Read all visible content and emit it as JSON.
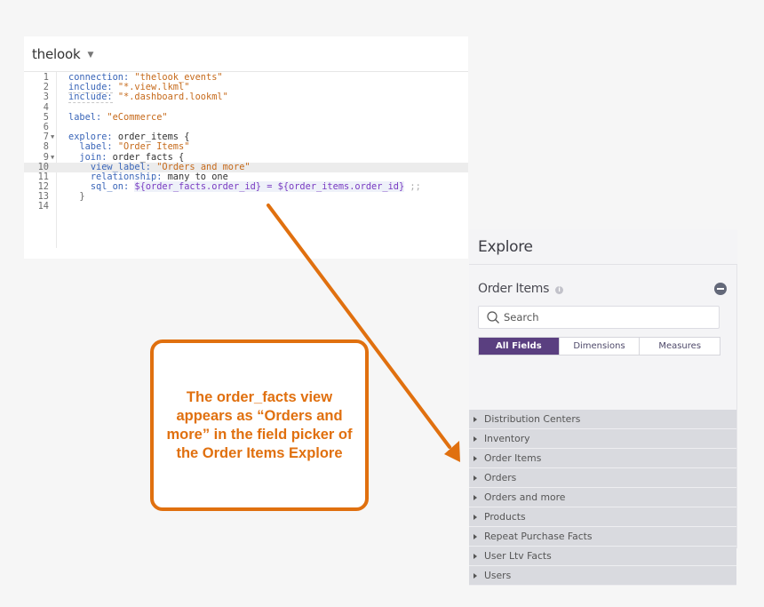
{
  "editor": {
    "project_name": "thelook",
    "lines": [
      {
        "n": "1"
      },
      {
        "n": "2"
      },
      {
        "n": "3"
      },
      {
        "n": "4"
      },
      {
        "n": "5"
      },
      {
        "n": "6"
      },
      {
        "n": "7"
      },
      {
        "n": "8"
      },
      {
        "n": "9"
      },
      {
        "n": "10"
      },
      {
        "n": "11"
      },
      {
        "n": "12"
      },
      {
        "n": "13"
      },
      {
        "n": "14"
      }
    ],
    "code": {
      "l1_key": "connection:",
      "l1_val": "\"thelook_events\"",
      "l2_key": "include:",
      "l2_val": "\"*.view.lkml\"",
      "l3_key": "include:",
      "l3_val": "\"*.dashboard.lookml\"",
      "l5_key": "label:",
      "l5_val": "\"eCommerce\"",
      "l7_key": "explore:",
      "l7_val": "order_items {",
      "l8_key": "label:",
      "l8_val": "\"Order Items\"",
      "l9_key": "join:",
      "l9_val": "order_facts {",
      "l10_key": "view_label:",
      "l10_val": "\"Orders and more\"",
      "l11_key": "relationship:",
      "l11_val": "many_to_one",
      "l12_key": "sql_on:",
      "l12_ref1": "${order_facts.order_id}",
      "l12_eq": " = ",
      "l12_ref2": "${order_items.order_id}",
      "l12_end": ";;",
      "l13_val": "}"
    },
    "active_line": "10"
  },
  "explore": {
    "title": "Explore",
    "model": "Order Items",
    "info_icon": "i",
    "search_placeholder": "Search",
    "filters": [
      {
        "label": "All Fields",
        "active": true
      },
      {
        "label": "Dimensions",
        "active": false
      },
      {
        "label": "Measures",
        "active": false
      }
    ],
    "sections": [
      "Distribution Centers",
      "Inventory",
      "Order Items",
      "Orders",
      "Orders and more",
      "Products",
      "Repeat Purchase Facts",
      "User Ltv Facts",
      "Users"
    ]
  },
  "callout": {
    "text": "The order_facts view appears as “Orders and more” in the field picker of the Order Items Explore",
    "color": "#e0700f"
  },
  "colors": {
    "accent_purple": "#5a3f80",
    "annotation_orange": "#e0700f"
  }
}
